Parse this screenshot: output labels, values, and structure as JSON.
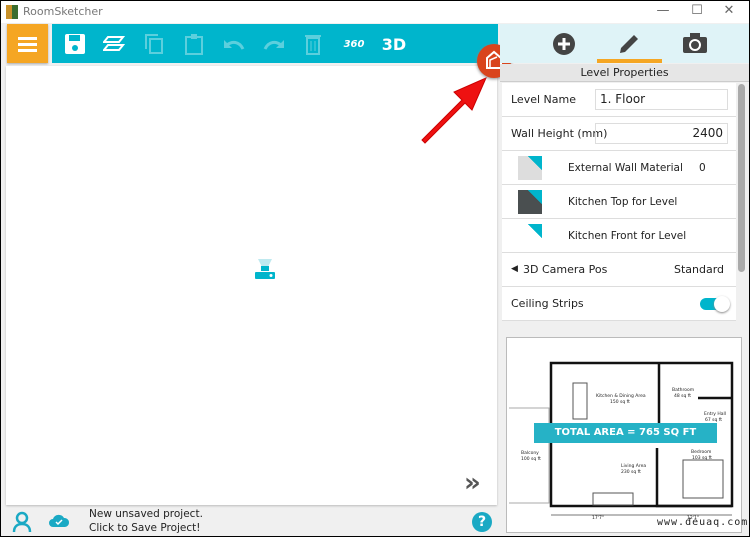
{
  "window": {
    "title": "RoomSketcher",
    "minimize": "—",
    "maximize": "☐",
    "close": "✕"
  },
  "toolbar": {
    "items": [
      "menu-icon",
      "save-icon",
      "layers-icon",
      "copy-icon",
      "paste-icon",
      "undo-icon",
      "redo-icon",
      "delete-icon",
      "view-360-icon",
      "view-3d"
    ],
    "label_360": "360",
    "label_3d": "3D"
  },
  "accent": {
    "teal": "#00b5cc",
    "orange": "#f5a623",
    "marker": "#d9441c",
    "arrow": "#ee1111"
  },
  "right_tabs": [
    {
      "icon": "add-icon"
    },
    {
      "icon": "pencil-icon",
      "active": true
    },
    {
      "icon": "camera-icon"
    }
  ],
  "level_properties": {
    "header": "Level Properties",
    "level_name_label": "Level Name",
    "level_name_value": "1. Floor",
    "wall_height_label": "Wall Height (mm)",
    "wall_height_value": "2400",
    "materials": [
      {
        "label": "External Wall Material",
        "value": "0"
      },
      {
        "label": "Kitchen Top for Level",
        "value": ""
      },
      {
        "label": "Kitchen Front for Level",
        "value": ""
      }
    ],
    "camera_label": "3D Camera Pos",
    "camera_value": "Standard",
    "ceiling_label": "Ceiling Strips",
    "ceiling_on": true
  },
  "floorplan": {
    "total": "TOTAL AREA = 765 SQ FT",
    "rooms": [
      {
        "name": "Kitchen & Dining Area",
        "area": "150 sq ft"
      },
      {
        "name": "Bathroom",
        "area": "48 sq ft"
      },
      {
        "name": "Entry Hall",
        "area": "67 sq ft"
      },
      {
        "name": "Balcony",
        "area": "100 sq ft"
      },
      {
        "name": "Living Area",
        "area": "230 sq ft"
      },
      {
        "name": "Bedroom",
        "area": "103 sq ft"
      }
    ],
    "dims": [
      "17'7\"",
      "12'1\""
    ],
    "watermark": "www.deuaq.com"
  },
  "status": {
    "line1": "New unsaved project.",
    "line2": "Click to Save Project!"
  }
}
